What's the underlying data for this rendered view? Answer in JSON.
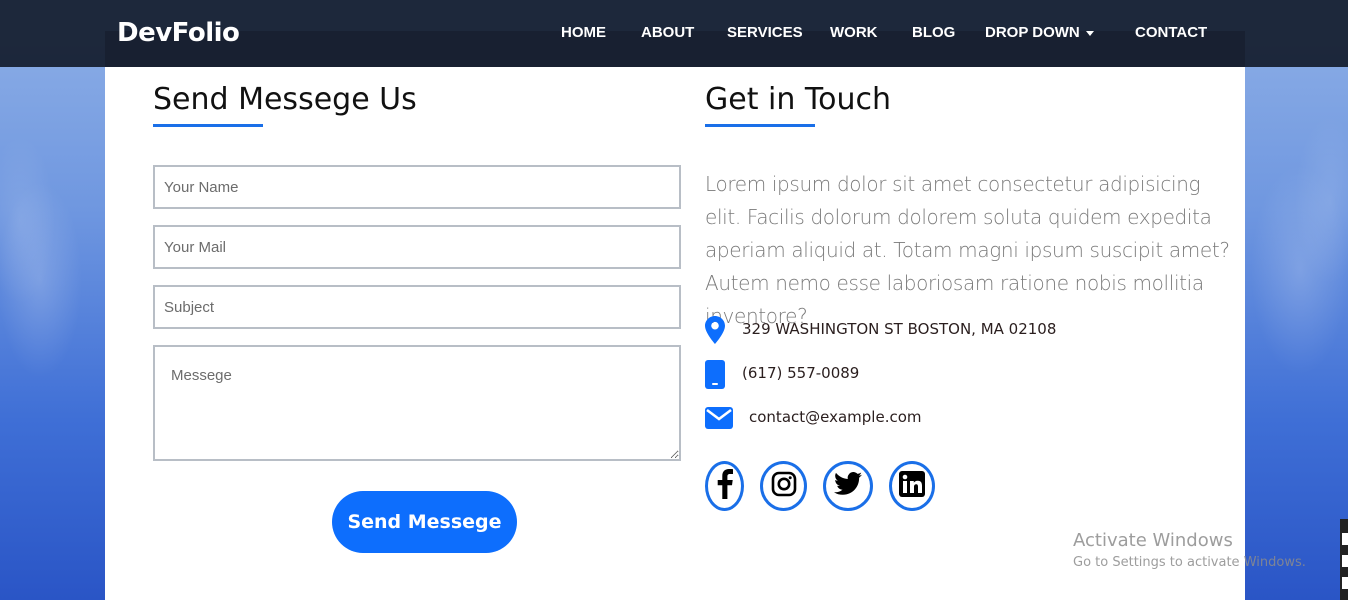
{
  "brand": "DevFolio",
  "nav": {
    "home": "HOME",
    "about": "ABOUT",
    "services": "SERVICES",
    "work": "WORK",
    "blog": "BLOG",
    "dropdown": "DROP DOWN",
    "contact": "CONTACT"
  },
  "form": {
    "title": "Send Messege Us",
    "name_placeholder": "Your Name",
    "mail_placeholder": "Your Mail",
    "subject_placeholder": "Subject",
    "message_placeholder": "Messege",
    "submit_label": "Send Messege"
  },
  "touch": {
    "title": "Get in Touch",
    "description": "Lorem ipsum dolor sit amet consectetur adipisicing elit. Facilis dolorum dolorem soluta quidem expedita aperiam aliquid at. Totam magni ipsum suscipit amet? Autem nemo esse laboriosam ratione nobis mollitia inventore?",
    "address": "329 WASHINGTON ST BOSTON, MA 02108",
    "phone": "(617) 557-0089",
    "email": "contact@example.com"
  },
  "social": [
    "facebook-icon",
    "instagram-icon",
    "twitter-icon",
    "linkedin-icon"
  ],
  "watermark": {
    "title": "Activate Windows",
    "subtitle": "Go to Settings to activate Windows."
  },
  "colors": {
    "accent": "#0d6efd",
    "navbar": "#141c2d",
    "underline": "#1a6fe8"
  }
}
